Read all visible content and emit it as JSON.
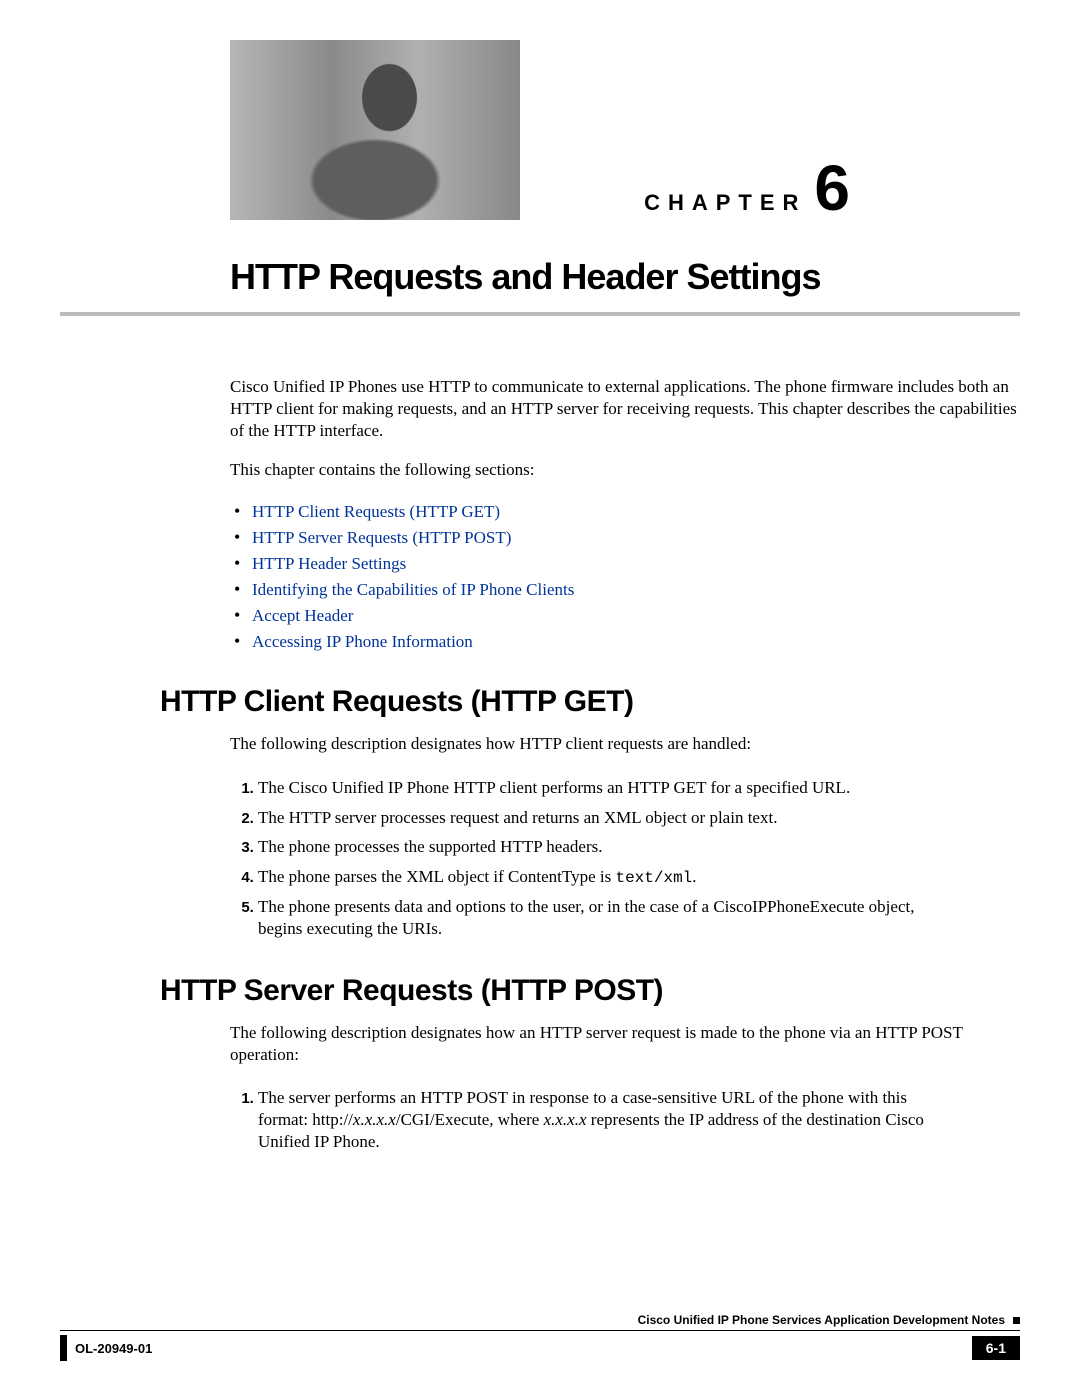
{
  "chapter": {
    "label": "CHAPTER",
    "number": "6",
    "title": "HTTP Requests and Header Settings"
  },
  "intro": {
    "p1": "Cisco Unified IP Phones use HTTP to communicate to external applications. The phone firmware includes both an HTTP client for making requests, and an HTTP server for receiving requests. This chapter describes the capabilities of the HTTP interface.",
    "p2": "This chapter contains the following sections:"
  },
  "toc": [
    "HTTP Client Requests (HTTP GET)",
    "HTTP Server Requests (HTTP POST)",
    "HTTP Header Settings",
    "Identifying the Capabilities of IP Phone Clients",
    "Accept Header",
    "Accessing IP Phone Information"
  ],
  "section1": {
    "heading": "HTTP Client Requests (HTTP GET)",
    "lead": "The following description designates how HTTP client requests are handled:",
    "steps": [
      "The Cisco Unified IP Phone HTTP client performs an HTTP GET for a specified URL.",
      "The HTTP server processes request and returns an XML object or plain text.",
      "The phone processes the supported HTTP headers.",
      "The phone parses the XML object if ContentType is ",
      "The phone presents data and options to the user, or in the case of a CiscoIPPhoneExecute object, begins executing the URIs."
    ],
    "step4_code": "text/xml",
    "step4_suffix": "."
  },
  "section2": {
    "heading": "HTTP Server Requests (HTTP POST)",
    "lead": "The following description designates how an HTTP server request is made to the phone via an HTTP POST operation:",
    "step1_a": "The server performs an HTTP POST in response to a case-sensitive URL of the phone with this format: http://",
    "step1_ip1": "x.x.x.x",
    "step1_b": "/CGI/Execute, where ",
    "step1_ip2": "x.x.x.x",
    "step1_c": " represents the IP address of the destination Cisco Unified IP Phone."
  },
  "footer": {
    "doc_title": "Cisco Unified IP Phone Services Application Development Notes",
    "doc_id": "OL-20949-01",
    "page": "6-1"
  }
}
